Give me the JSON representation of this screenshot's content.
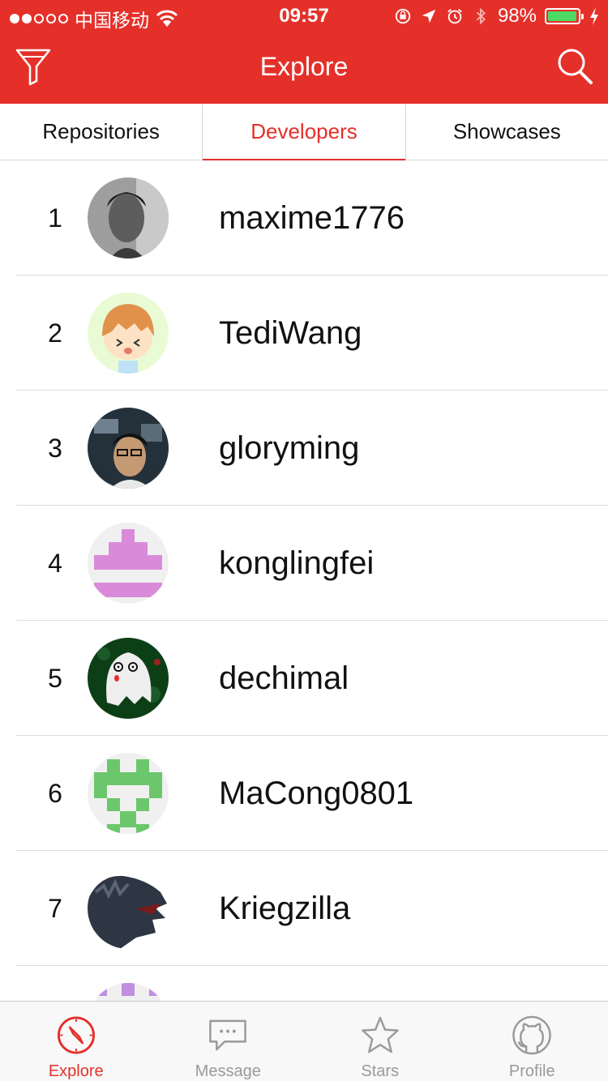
{
  "status_bar": {
    "carrier": "中国移动",
    "time": "09:57",
    "battery_percent": "98%",
    "battery_level": 0.98,
    "signal_bars_filled": 2,
    "signal_bars_total": 5
  },
  "nav": {
    "title": "Explore",
    "left_icon": "filter-icon",
    "right_icon": "search-icon"
  },
  "tabs": [
    {
      "label": "Repositories",
      "active": false
    },
    {
      "label": "Developers",
      "active": true
    },
    {
      "label": "Showcases",
      "active": false
    }
  ],
  "developers": [
    {
      "rank": "1",
      "username": "maxime1776",
      "avatar": "photo-grayscale"
    },
    {
      "rank": "2",
      "username": "TediWang",
      "avatar": "cartoon-boy"
    },
    {
      "rank": "3",
      "username": "gloryming",
      "avatar": "photo-glasses"
    },
    {
      "rank": "4",
      "username": "konglingfei",
      "avatar": "identicon-pink"
    },
    {
      "rank": "5",
      "username": "dechimal",
      "avatar": "ghost"
    },
    {
      "rank": "6",
      "username": "MaCong0801",
      "avatar": "identicon-green"
    },
    {
      "rank": "7",
      "username": "Kriegzilla",
      "avatar": "godzilla"
    }
  ],
  "tabbar": [
    {
      "label": "Explore",
      "icon": "compass-icon",
      "active": true
    },
    {
      "label": "Message",
      "icon": "chat-bubble-icon",
      "active": false
    },
    {
      "label": "Stars",
      "icon": "star-icon",
      "active": false
    },
    {
      "label": "Profile",
      "icon": "github-octocat-icon",
      "active": false
    }
  ],
  "colors": {
    "accent": "#e5302a",
    "tabbar_inactive": "#9a9a9a",
    "battery_fill": "#4cd964"
  }
}
